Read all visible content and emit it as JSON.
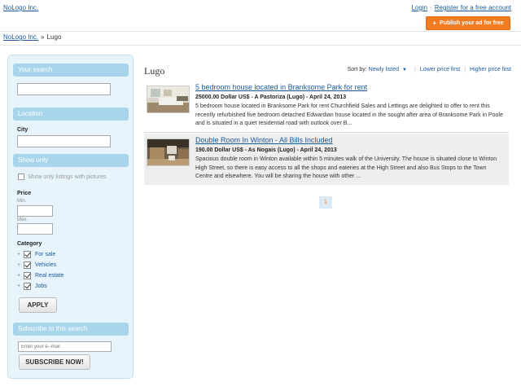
{
  "header": {
    "logo": "NoLogo Inc.",
    "login": "Login",
    "separator": "·",
    "register": "Register for a free account",
    "publish_icon": "+",
    "publish_label": "Publish your ad for free"
  },
  "breadcrumb": {
    "home": "NoLogo Inc.",
    "separator": "»",
    "current": "Lugo"
  },
  "sidebar": {
    "search_heading": "Your search",
    "search_value": "",
    "location_heading": "Location",
    "city_label": "City",
    "city_value": "",
    "show_only_heading": "Show only",
    "pictures_label": "Show only listings with pictures",
    "price_label": "Price",
    "min_label": "Min.",
    "max_label": "Max.",
    "category_label": "Category",
    "categories": [
      {
        "label": "For sale",
        "checked": true
      },
      {
        "label": "Vehicles",
        "checked": true
      },
      {
        "label": "Real estate",
        "checked": true
      },
      {
        "label": "Jobs",
        "checked": true
      }
    ],
    "apply_label": "APPLY",
    "subscribe_heading": "Subscribe to this search",
    "email_placeholder": "Enter your e--mail",
    "subscribe_label": "SUBSCRIBE NOW!"
  },
  "main": {
    "title": "Lugo",
    "sort": {
      "prefix": "Sort by:",
      "active": "Newly listed",
      "arrow": "▼",
      "lower": "Lower price first",
      "higher": "Higher price first",
      "separator": "|"
    },
    "listings": [
      {
        "title": "5 bedroom house located in Branksome Park for rent",
        "meta": "25000.00 Dollar US$ - A Pastoriza (Lugo) - April 24, 2013",
        "description": "5 bedroom house located in Branksome Park for rent Churchfield Sales and Lettings are delighted to offer to rent this recently refurbished five bedroom detached Edwardian house located in the sought after area of Branksome Park in Poole and is situated in a quiet residential road with outlook over B..."
      },
      {
        "title": "Double Room In Winton - All Bills Included",
        "meta": "190.00 Dollar US$ - As Nogais (Lugo) - April 24, 2013",
        "description": "Spacious double room in Winton available within 5 minutes walk of the University. The house is situated close to Winton High Street, so there is easy access to all the shops and eateries at the High Street and also Bus Stops to the Town Centre and elsewhere. You will be sharing the house with other ..."
      }
    ],
    "page": "1"
  }
}
